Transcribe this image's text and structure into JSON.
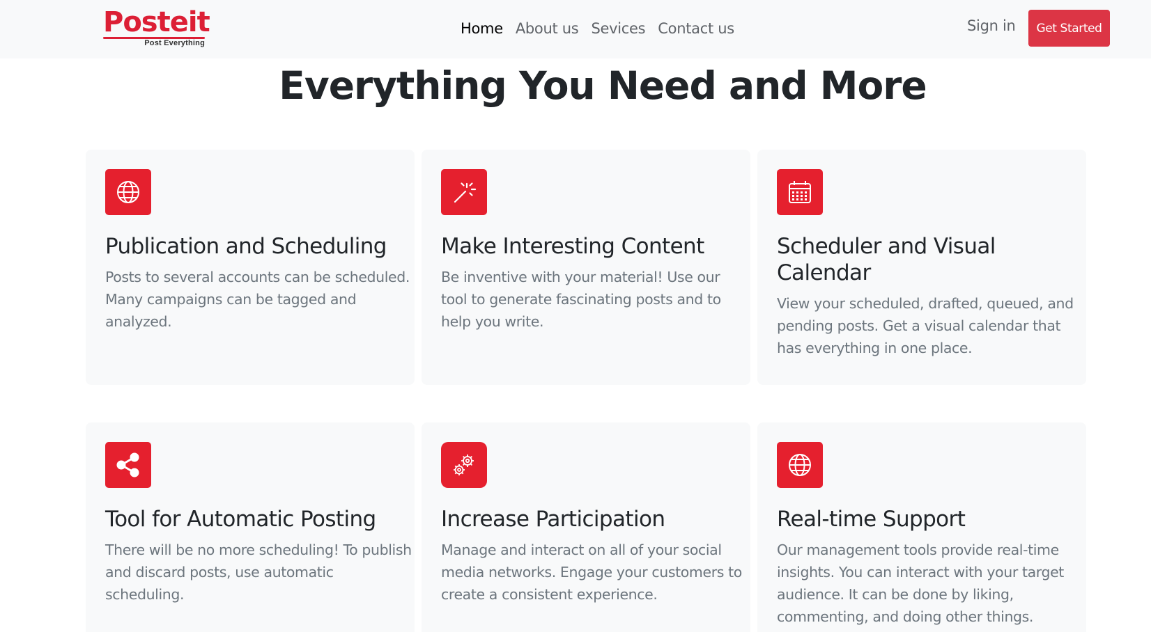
{
  "navbar": {
    "logo_text": "Posteit",
    "logo_tagline": "Post Everything",
    "links": [
      {
        "label": "Home",
        "active": true
      },
      {
        "label": "About us",
        "active": false
      },
      {
        "label": "Sevices",
        "active": false
      },
      {
        "label": "Contact us",
        "active": false
      }
    ],
    "signin_label": "Sign in",
    "cta_label": "Get Started"
  },
  "section": {
    "heading": "Everything You Need and More"
  },
  "features": [
    {
      "icon": "globe-icon",
      "title": "Publication and Scheduling",
      "text": "Posts to several accounts can be scheduled. Many campaigns can be tagged and analyzed."
    },
    {
      "icon": "magic-wand-icon",
      "title": "Make Interesting Content",
      "text": "Be inventive with your material! Use our tool to generate fascinating posts and to help you write."
    },
    {
      "icon": "calendar-icon",
      "title": "Scheduler and Visual Calendar",
      "text": "View your scheduled, drafted, queued, and pending posts. Get a visual calendar that has everything in one place."
    },
    {
      "icon": "share-icon",
      "title": "Tool for Automatic Posting",
      "text": "There will be no more scheduling! To publish and discard posts, use automatic scheduling."
    },
    {
      "icon": "gears-icon",
      "title": "Increase Participation",
      "text": "Manage and interact on all of your social media networks. Engage your customers to create a consistent experience."
    },
    {
      "icon": "globe-icon",
      "title": "Real-time Support",
      "text": "Our management tools provide real-time insights. You can interact with your target audience. It can be done by liking, commenting, and doing other things."
    }
  ],
  "colors": {
    "brand_red": "#dc3545",
    "icon_tile": "#e5202e",
    "card_bg": "#f8f9fa",
    "muted_text": "#6c757d"
  }
}
